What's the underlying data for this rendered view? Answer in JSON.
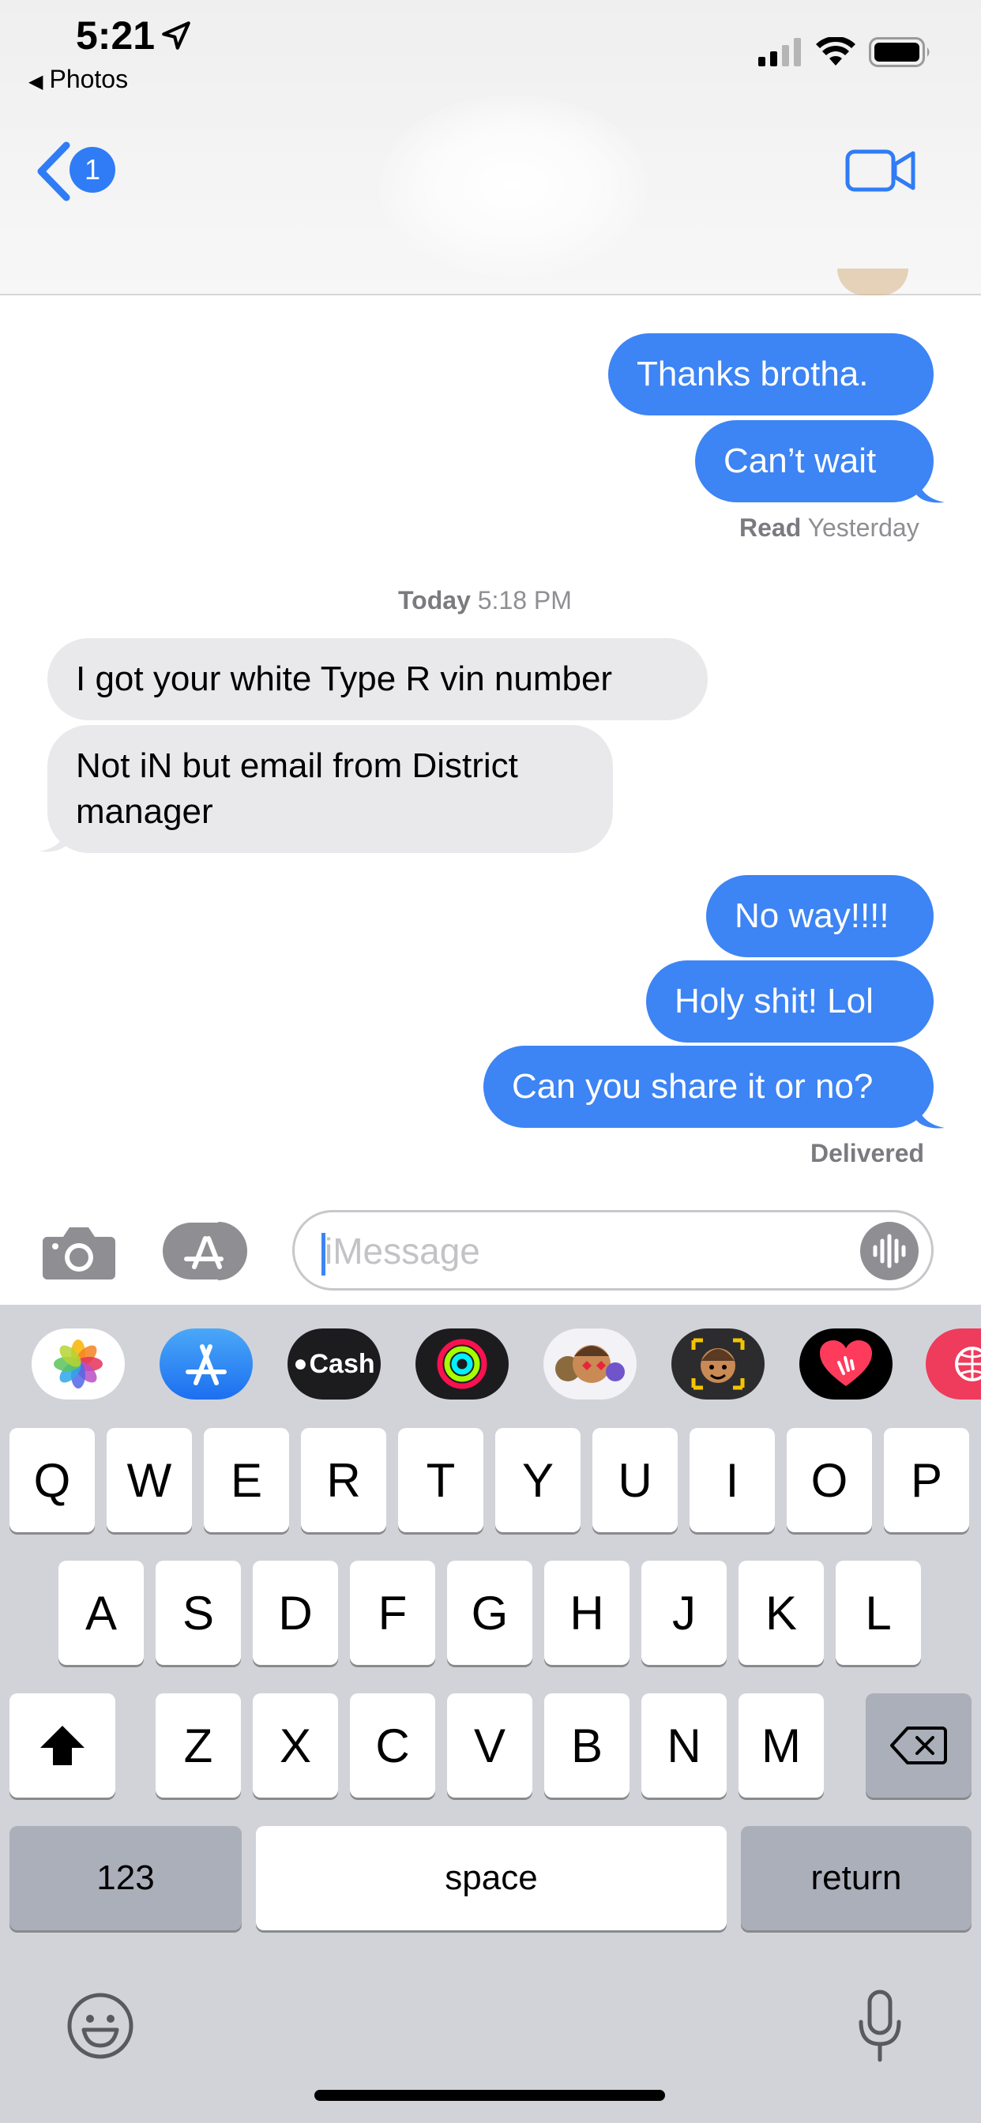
{
  "status_bar": {
    "time": "5:21",
    "back_app": "Photos"
  },
  "nav": {
    "badge_count": "1"
  },
  "messages": [
    {
      "dir": "out",
      "text": "Thanks brotha."
    },
    {
      "dir": "out",
      "text": "Can’t wait"
    },
    {
      "dir": "in",
      "text": "I got your white Type R vin number"
    },
    {
      "dir": "in",
      "text_line1": "Not iN but email from District",
      "text_line2": "manager"
    },
    {
      "dir": "out",
      "text": "No way!!!!"
    },
    {
      "dir": "out",
      "text": "Holy shit! Lol"
    },
    {
      "dir": "out",
      "text": "Can you share it or no?"
    }
  ],
  "receipts": {
    "read_label": "Read",
    "read_time": "Yesterday",
    "delivered": "Delivered"
  },
  "timestamp": {
    "day": "Today",
    "time": "5:18 PM"
  },
  "composer": {
    "placeholder": "iMessage"
  },
  "app_strip": {
    "items": [
      "photos-app",
      "app-store-app",
      "apple-cash-app",
      "activity-app",
      "memoji-stickers-app",
      "memoji-app",
      "digital-touch-app",
      "search-images-app"
    ],
    "cash_label": "Cash"
  },
  "keyboard": {
    "row1": [
      "Q",
      "W",
      "E",
      "R",
      "T",
      "Y",
      "U",
      "I",
      "O",
      "P"
    ],
    "row2": [
      "A",
      "S",
      "D",
      "F",
      "G",
      "H",
      "J",
      "K",
      "L"
    ],
    "row3": [
      "Z",
      "X",
      "C",
      "V",
      "B",
      "N",
      "M"
    ],
    "numbers_label": "123",
    "space_label": "space",
    "return_label": "return"
  },
  "colors": {
    "accent": "#3d84f4",
    "incoming": "#e9e9eb",
    "keyboard_bg": "#d1d3d9"
  }
}
